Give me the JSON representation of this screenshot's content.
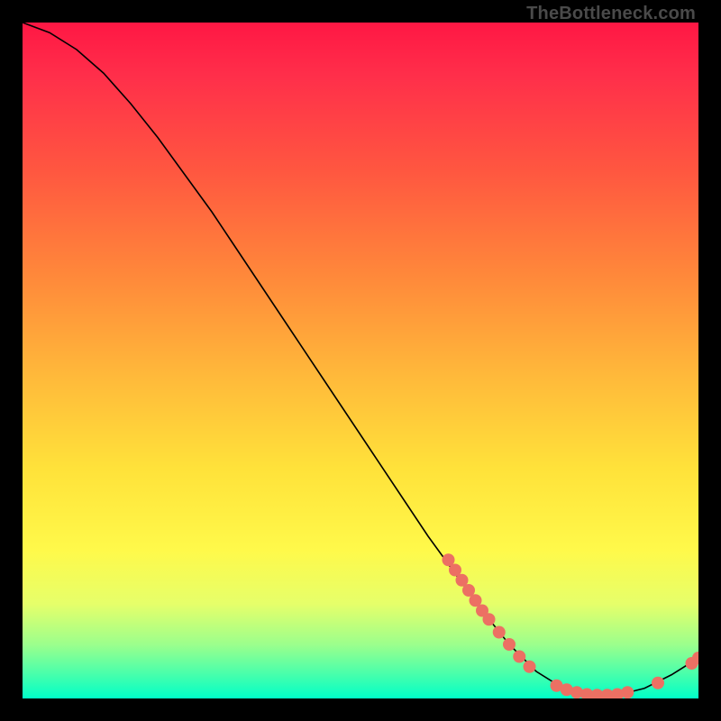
{
  "watermark": "TheBottleneck.com",
  "chart_data": {
    "type": "line",
    "title": "",
    "xlabel": "",
    "ylabel": "",
    "xlim": [
      0,
      100
    ],
    "ylim": [
      0,
      100
    ],
    "curve": {
      "x": [
        0,
        4,
        8,
        12,
        16,
        20,
        24,
        28,
        32,
        36,
        40,
        44,
        48,
        52,
        56,
        60,
        64,
        68,
        72,
        76,
        80,
        84,
        88,
        92,
        96,
        100
      ],
      "y": [
        100,
        98.5,
        96,
        92.5,
        88,
        83,
        77.5,
        72,
        66,
        60,
        54,
        48,
        42,
        36,
        30,
        24,
        18.5,
        13,
        8,
        4,
        1.5,
        0.5,
        0.5,
        1.5,
        3.5,
        6
      ]
    },
    "markers": [
      {
        "x": 63,
        "y": 20.5
      },
      {
        "x": 64,
        "y": 19
      },
      {
        "x": 65,
        "y": 17.5
      },
      {
        "x": 66,
        "y": 16
      },
      {
        "x": 67,
        "y": 14.5
      },
      {
        "x": 68,
        "y": 13
      },
      {
        "x": 69,
        "y": 11.7
      },
      {
        "x": 70.5,
        "y": 9.8
      },
      {
        "x": 72,
        "y": 8
      },
      {
        "x": 73.5,
        "y": 6.2
      },
      {
        "x": 75,
        "y": 4.7
      },
      {
        "x": 79,
        "y": 1.9
      },
      {
        "x": 80.5,
        "y": 1.3
      },
      {
        "x": 82,
        "y": 0.9
      },
      {
        "x": 83.5,
        "y": 0.6
      },
      {
        "x": 85,
        "y": 0.5
      },
      {
        "x": 86.5,
        "y": 0.5
      },
      {
        "x": 88,
        "y": 0.6
      },
      {
        "x": 89.5,
        "y": 0.9
      },
      {
        "x": 94,
        "y": 2.3
      },
      {
        "x": 99,
        "y": 5.2
      },
      {
        "x": 100,
        "y": 6
      }
    ],
    "marker_color": "#ec7063"
  }
}
